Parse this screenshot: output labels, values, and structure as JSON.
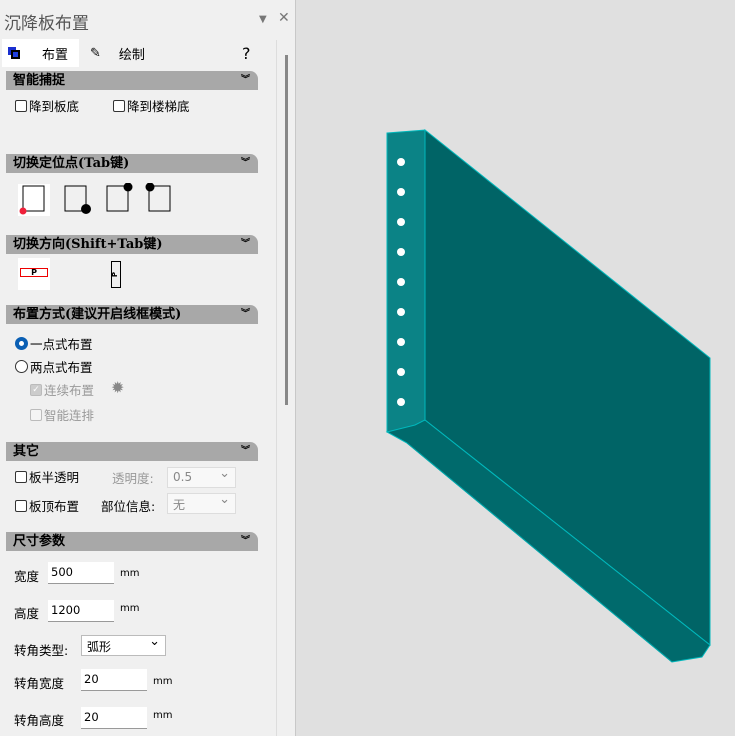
{
  "panel": {
    "title": "沉降板布置",
    "tabs": [
      {
        "label": "布置"
      },
      {
        "label": "绘制"
      }
    ],
    "help": "?"
  },
  "sections": {
    "snap": {
      "title": "智能捕捉",
      "items": [
        "降到板底",
        "降到楼梯底"
      ]
    },
    "anchor": {
      "title": "切换定位点(Tab键)"
    },
    "direction": {
      "title": "切换方向(Shift+Tab键)",
      "glyph": "P"
    },
    "mode": {
      "title": "布置方式(建议开启线框模式)",
      "one_point": "一点式布置",
      "two_point": "两点式布置",
      "continuous": "连续布置",
      "smart": "智能连排",
      "selected": "one_point"
    },
    "other": {
      "title": "其它",
      "semi_transparent": "板半透明",
      "opacity_label": "透明度:",
      "opacity_value": "0.5",
      "top_place": "板顶布置",
      "part_label": "部位信息:",
      "part_value": "无"
    },
    "size": {
      "title": "尺寸参数",
      "width_label": "宽度",
      "width_value": "500",
      "height_label": "高度",
      "height_value": "1200",
      "unit": "mm",
      "corner_type_label": "转角类型:",
      "corner_type_value": "弧形",
      "corner_width_label": "转角宽度",
      "corner_width_value": "20",
      "corner_height_label": "转角高度",
      "corner_height_value": "20"
    }
  },
  "colors": {
    "accent": "#0a5fb4",
    "slab_side": "#006466",
    "slab_front": "#0b8386",
    "slab_bottom": "#006a6c"
  }
}
